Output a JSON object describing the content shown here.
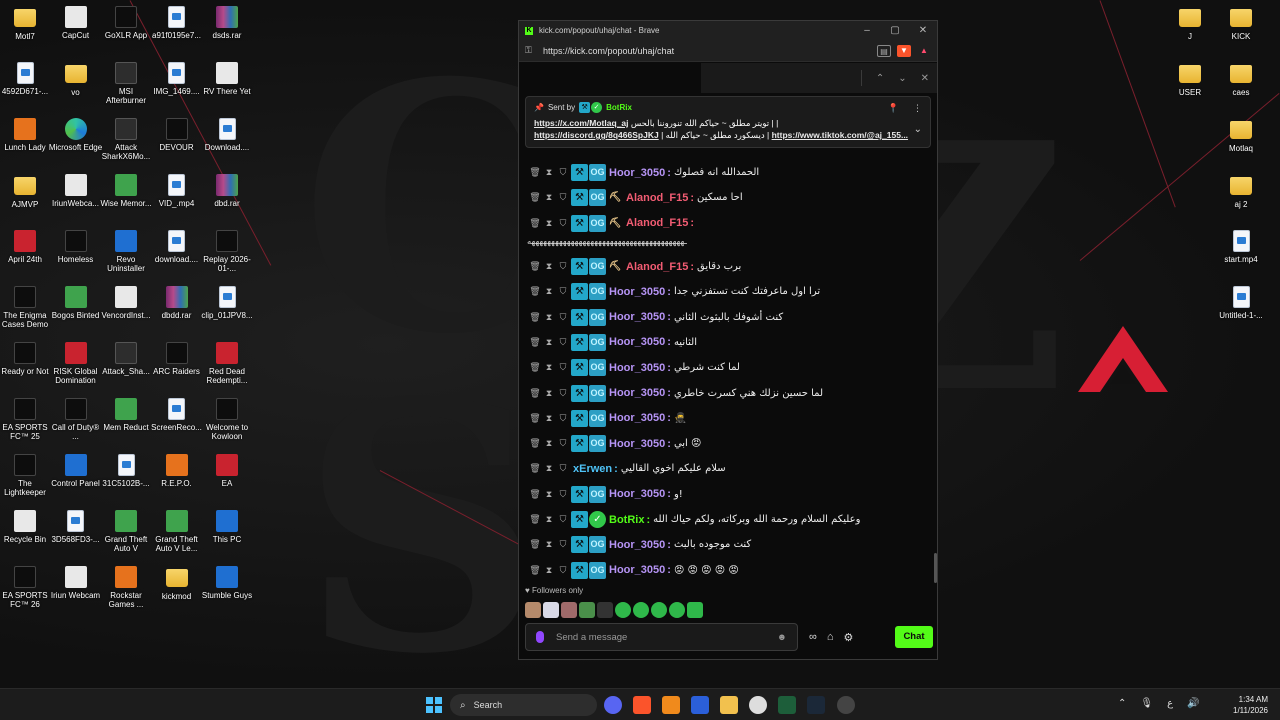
{
  "desktop": {
    "left_icons": [
      {
        "label": "Motl7",
        "type": "folder"
      },
      {
        "label": "CapCut",
        "type": "white"
      },
      {
        "label": "GoXLR App",
        "type": "dark"
      },
      {
        "label": "a91f0195e7...",
        "type": "file"
      },
      {
        "label": "dsds.rar",
        "type": "rar"
      },
      {
        "label": "4592D671-...",
        "type": "file"
      },
      {
        "label": "vo",
        "type": "folder"
      },
      {
        "label": "MSI Afterburner",
        "type": "app"
      },
      {
        "label": "IMG_1469....",
        "type": "file"
      },
      {
        "label": "RV There Yet",
        "type": "white"
      },
      {
        "label": "Lunch Lady",
        "type": "orange"
      },
      {
        "label": "Microsoft Edge",
        "type": "edge"
      },
      {
        "label": "Attack SharkX6Mo...",
        "type": "app"
      },
      {
        "label": "DEVOUR",
        "type": "dark"
      },
      {
        "label": "Download....",
        "type": "file"
      },
      {
        "label": "AJMVP",
        "type": "folder"
      },
      {
        "label": "IriunWebca...",
        "type": "white"
      },
      {
        "label": "Wise Memor...",
        "type": "green"
      },
      {
        "label": "VID_.mp4",
        "type": "file"
      },
      {
        "label": "dbd.rar",
        "type": "rar"
      },
      {
        "label": "April 24th",
        "type": "red"
      },
      {
        "label": "Homeless",
        "type": "dark"
      },
      {
        "label": "Revo Uninstaller",
        "type": "blue"
      },
      {
        "label": "download....",
        "type": "file"
      },
      {
        "label": "Replay 2026-01-...",
        "type": "dark"
      },
      {
        "label": "The Enigma Cases Demo",
        "type": "dark"
      },
      {
        "label": "Bogos Binted",
        "type": "green"
      },
      {
        "label": "VencordInst...",
        "type": "white"
      },
      {
        "label": "dbdd.rar",
        "type": "rar"
      },
      {
        "label": "clip_01JPV8...",
        "type": "file"
      },
      {
        "label": "Ready or Not",
        "type": "dark"
      },
      {
        "label": "RISK Global Domination",
        "type": "red"
      },
      {
        "label": "Attack_Sha...",
        "type": "app"
      },
      {
        "label": "ARC Raiders",
        "type": "dark"
      },
      {
        "label": "Red Dead Redempti...",
        "type": "red"
      },
      {
        "label": "EA SPORTS FC™ 25",
        "type": "dark"
      },
      {
        "label": "Call of Duty® ...",
        "type": "dark"
      },
      {
        "label": "Mem Reduct",
        "type": "green"
      },
      {
        "label": "ScreenReco...",
        "type": "file"
      },
      {
        "label": "Welcome to Kowloon",
        "type": "dark"
      },
      {
        "label": "The Lightkeeper",
        "type": "dark"
      },
      {
        "label": "Control Panel",
        "type": "blue"
      },
      {
        "label": "31C5102B-...",
        "type": "file"
      },
      {
        "label": "R.E.P.O.",
        "type": "orange"
      },
      {
        "label": "EA",
        "type": "red"
      },
      {
        "label": "Recycle Bin",
        "type": "white"
      },
      {
        "label": "3D568FD3-...",
        "type": "file"
      },
      {
        "label": "Grand Theft Auto V",
        "type": "green"
      },
      {
        "label": "Grand Theft Auto V Le...",
        "type": "green"
      },
      {
        "label": "This PC",
        "type": "blue"
      },
      {
        "label": "EA SPORTS FC™ 26",
        "type": "dark"
      },
      {
        "label": "Iriun Webcam",
        "type": "white"
      },
      {
        "label": "Rockstar Games ...",
        "type": "orange"
      },
      {
        "label": "kickmod",
        "type": "folder"
      },
      {
        "label": "Stumble Guys",
        "type": "blue"
      }
    ],
    "right_icons": [
      {
        "label": "J",
        "type": "folder"
      },
      {
        "label": "KICK",
        "type": "folder"
      },
      {
        "label": "USER",
        "type": "folder"
      },
      {
        "label": "caes",
        "type": "folder"
      },
      {
        "label": "Motlaq",
        "type": "folder"
      },
      {
        "label": "aj 2",
        "type": "folder"
      },
      {
        "label": "start.mp4",
        "type": "file"
      },
      {
        "label": "Untitled-1-...",
        "type": "file"
      }
    ]
  },
  "browser": {
    "title": "kick.com/popout/uhaj/chat - Brave",
    "url": "https://kick.com/popout/uhaj/chat",
    "favicon": "K"
  },
  "pinned": {
    "sent_by": "Sent by",
    "sender": "BotRix",
    "line1_text": "تويتر مطلق ~ حياكم الله تنوروننا بالحس |",
    "line1_link": "https://x.com/Motlaq_aj",
    "line1_tail": "|",
    "line2_link1": "https://discord.gg/8q466SpJKJ",
    "line2_text": "| ديسكورد مطلق ~ حياكم الله |",
    "line2_link2": "https://www.tiktok.com/@aj_155..."
  },
  "messages": [
    {
      "user": "Hoor_3050",
      "color": "hoor",
      "badges": [
        "mod",
        "og"
      ],
      "text": "الحمدالله انه فصلوك"
    },
    {
      "user": "Alanod_F15",
      "color": "alanod",
      "badges": [
        "mod",
        "og",
        "pick"
      ],
      "text": "احا مسكين"
    },
    {
      "user": "Alanod_F15",
      "color": "alanod",
      "badges": [
        "mod",
        "og",
        "pick"
      ],
      "text": ""
    },
    {
      "wrap": "ـهههههههههههههههههههههههههههههههههههههههه"
    },
    {
      "user": "Alanod_F15",
      "color": "alanod",
      "badges": [
        "mod",
        "og",
        "pick"
      ],
      "text": "برب دقايق"
    },
    {
      "user": "Hoor_3050",
      "color": "hoor",
      "badges": [
        "mod",
        "og"
      ],
      "text": "ترا اول ماعرفتك كنت تستفزني جدا"
    },
    {
      "user": "Hoor_3050",
      "color": "hoor",
      "badges": [
        "mod",
        "og"
      ],
      "text": "كنت أشوفك بالبثوث الثاني"
    },
    {
      "user": "Hoor_3050",
      "color": "hoor",
      "badges": [
        "mod",
        "og"
      ],
      "text": "الثانيه"
    },
    {
      "user": "Hoor_3050",
      "color": "hoor",
      "badges": [
        "mod",
        "og"
      ],
      "text": "لما كنت شرطي"
    },
    {
      "user": "Hoor_3050",
      "color": "hoor",
      "badges": [
        "mod",
        "og"
      ],
      "text": "لما حسين نزلك هني كسرت خاطري"
    },
    {
      "user": "Hoor_3050",
      "color": "hoor",
      "badges": [
        "mod",
        "og"
      ],
      "text": "🥷"
    },
    {
      "user": "Hoor_3050",
      "color": "hoor",
      "badges": [
        "mod",
        "og"
      ],
      "text": "ابي 😡"
    },
    {
      "user": "xErwen",
      "color": "xerwen",
      "badges": [],
      "text": "سلام عليكم اخوي القاليي"
    },
    {
      "user": "Hoor_3050",
      "color": "hoor",
      "badges": [
        "mod",
        "og"
      ],
      "text": "و!"
    },
    {
      "user": "BotRix",
      "color": "botrix",
      "badges": [
        "mod",
        "bot"
      ],
      "text": "وعليكم السلام ورحمة الله وبركاته، ولكم حياك الله"
    },
    {
      "user": "Hoor_3050",
      "color": "hoor",
      "badges": [
        "mod",
        "og"
      ],
      "text": "كنت موجوده بالبث"
    },
    {
      "user": "Hoor_3050",
      "color": "hoor",
      "badges": [
        "mod",
        "og"
      ],
      "text": "😡 😡 😡 😡 😡"
    }
  ],
  "chat": {
    "followers_only": "Followers only",
    "input_placeholder": "Send a message",
    "chat_button": "Chat",
    "accent": "#53fc18"
  },
  "taskbar": {
    "search_label": "Search",
    "time": "1:34 AM",
    "date": "1/11/2026",
    "lang": "ع"
  }
}
